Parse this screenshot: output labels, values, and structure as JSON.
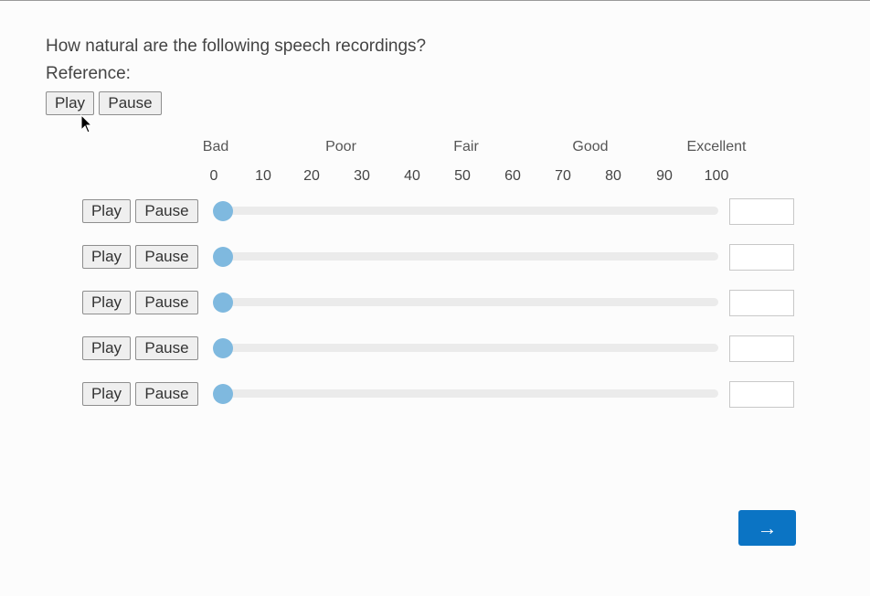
{
  "question": "How natural are the following speech recordings?",
  "reference": {
    "label": "Reference:",
    "play_label": "Play",
    "pause_label": "Pause"
  },
  "scale": {
    "labels": [
      "Bad",
      "Poor",
      "Fair",
      "Good",
      "Excellent"
    ],
    "ticks": [
      "0",
      "10",
      "20",
      "30",
      "40",
      "50",
      "60",
      "70",
      "80",
      "90",
      "100"
    ]
  },
  "rows": [
    {
      "play_label": "Play",
      "pause_label": "Pause",
      "value": 0,
      "input_value": ""
    },
    {
      "play_label": "Play",
      "pause_label": "Pause",
      "value": 0,
      "input_value": ""
    },
    {
      "play_label": "Play",
      "pause_label": "Pause",
      "value": 0,
      "input_value": ""
    },
    {
      "play_label": "Play",
      "pause_label": "Pause",
      "value": 0,
      "input_value": ""
    },
    {
      "play_label": "Play",
      "pause_label": "Pause",
      "value": 0,
      "input_value": ""
    }
  ],
  "next_button": {
    "label": "→",
    "icon": "arrow-right-icon"
  },
  "colors": {
    "accent": "#0b74c4",
    "slider_thumb": "#7fb9df",
    "slider_track": "#ebebeb"
  }
}
